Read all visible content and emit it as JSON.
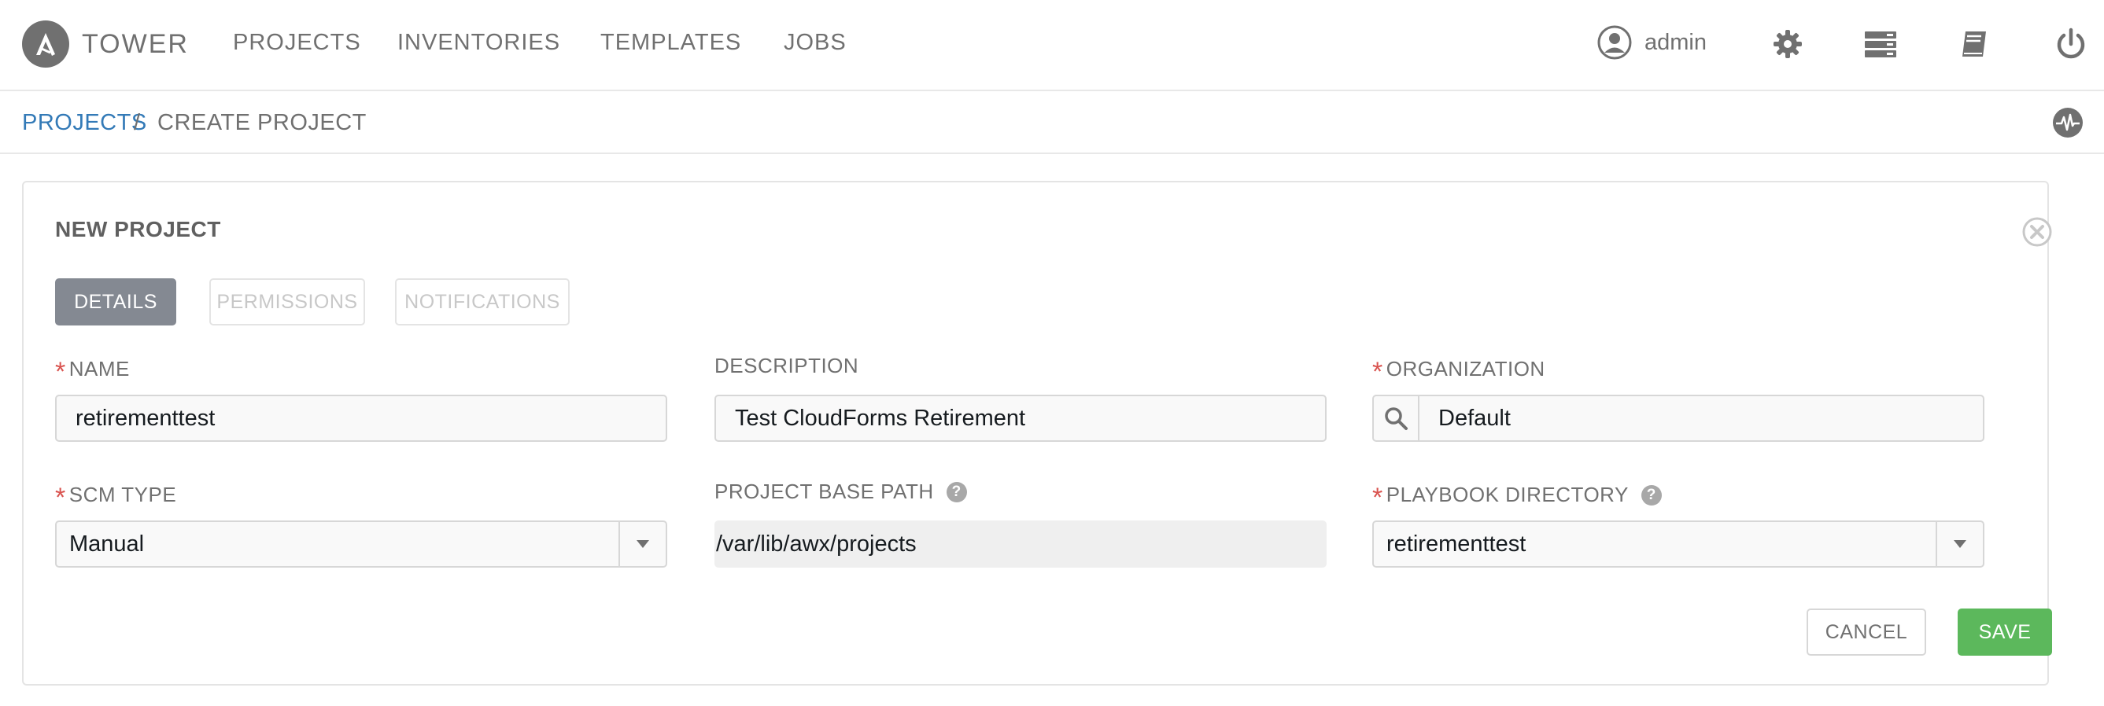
{
  "app": {
    "brand": "TOWER",
    "accent_color": "#337ab7",
    "required_color": "#d9534f",
    "save_color": "#5cb85c"
  },
  "nav": {
    "items": [
      {
        "label": "PROJECTS"
      },
      {
        "label": "INVENTORIES"
      },
      {
        "label": "TEMPLATES"
      },
      {
        "label": "JOBS"
      }
    ],
    "user": "admin",
    "icons": [
      "user-icon",
      "gear-icon",
      "server-icon",
      "book-icon",
      "power-icon"
    ]
  },
  "breadcrumb": {
    "parent": "PROJECTS",
    "separator": "/",
    "current": "CREATE PROJECT"
  },
  "form": {
    "title": "NEW PROJECT",
    "tabs": [
      {
        "label": "DETAILS",
        "active": true
      },
      {
        "label": "PERMISSIONS",
        "active": false
      },
      {
        "label": "NOTIFICATIONS",
        "active": false
      }
    ],
    "name": {
      "label": "NAME",
      "required": true,
      "value": "retirementtest"
    },
    "description": {
      "label": "DESCRIPTION",
      "required": false,
      "value": "Test CloudForms Retirement"
    },
    "organization": {
      "label": "ORGANIZATION",
      "required": true,
      "value": "Default"
    },
    "scm_type": {
      "label": "SCM TYPE",
      "required": true,
      "value": "Manual"
    },
    "base_path": {
      "label": "PROJECT BASE PATH",
      "value": "/var/lib/awx/projects"
    },
    "playbook_dir": {
      "label": "PLAYBOOK DIRECTORY",
      "required": true,
      "value": "retirementtest"
    },
    "required_mark": "*",
    "help_mark": "?",
    "cancel_label": "CANCEL",
    "save_label": "SAVE"
  }
}
